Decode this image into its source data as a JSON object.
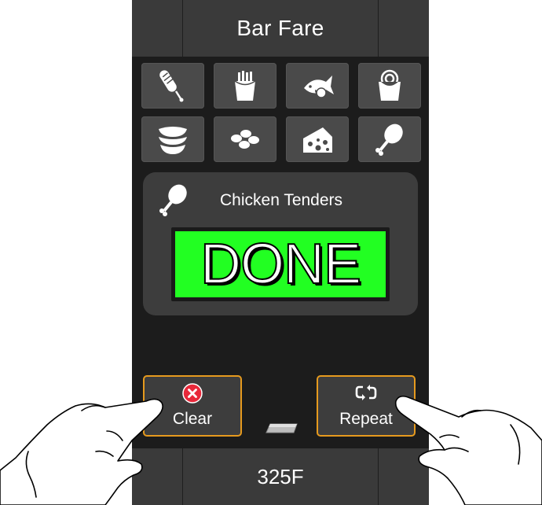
{
  "header": {
    "title": "Bar Fare"
  },
  "food_grid": [
    {
      "icon": "corndog-icon"
    },
    {
      "icon": "fries-icon"
    },
    {
      "icon": "fish-icon"
    },
    {
      "icon": "popcorn-shrimp-icon"
    },
    {
      "icon": "onion-rings-icon"
    },
    {
      "icon": "nuggets-icon"
    },
    {
      "icon": "cheese-icon"
    },
    {
      "icon": "drumstick-icon"
    }
  ],
  "status": {
    "icon": "drumstick-icon",
    "item_name": "Chicken Tenders",
    "state": "DONE",
    "state_color": "#22ff22"
  },
  "actions": {
    "clear_label": "Clear",
    "clear_icon": "x-circle-icon",
    "repeat_label": "Repeat",
    "repeat_icon": "repeat-icon",
    "accent": "#e69a1e"
  },
  "footer": {
    "temperature": "325F"
  }
}
